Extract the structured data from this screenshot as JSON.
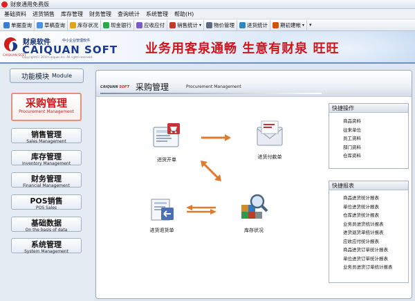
{
  "window": {
    "title": "财泉通用免费版"
  },
  "menu": [
    "基础资料",
    "进货销售",
    "库存管理",
    "财务管理",
    "查询统计",
    "系统管理",
    "帮助(H)"
  ],
  "toolbar": [
    {
      "label": "单据查询",
      "icon": "document-search-icon",
      "color": "#3a7bd5",
      "dropdown": false
    },
    {
      "label": "草稿查询",
      "icon": "draft-icon",
      "color": "#4a90e2",
      "dropdown": false
    },
    {
      "label": "库存状况",
      "icon": "inventory-icon",
      "color": "#e0a31a",
      "dropdown": false
    },
    {
      "label": "现金银行",
      "icon": "bank-icon",
      "color": "#2aa84a",
      "dropdown": false
    },
    {
      "label": "应收应付",
      "icon": "receivable-icon",
      "color": "#7a5cc8",
      "dropdown": false
    },
    {
      "label": "销售统计",
      "icon": "sales-chart-icon",
      "color": "#c0392b",
      "dropdown": true
    },
    {
      "label": "物价管理",
      "icon": "price-grid-icon",
      "color": "#5b6b7f",
      "dropdown": false
    },
    {
      "label": "进货统计",
      "icon": "purchase-chart-icon",
      "color": "#2e86c1",
      "dropdown": false
    },
    {
      "label": "期初建帐",
      "icon": "opening-account-icon",
      "color": "#d35400",
      "dropdown": true
    }
  ],
  "toolbar_more": "▾",
  "banner": {
    "logo_cn": "财泉软件",
    "logo_tagline": "中小企业管理软件",
    "logo_en": "CAIQUAN SOFT",
    "logo_small": "CAIQUAN SOFT",
    "copyright": "Copyright(C) 2010 Caiquan Inc. All rights reserved.",
    "slogan": "业务用客泉通畅    生意有财泉 旺旺"
  },
  "sidebar": {
    "header_cn": "功能模块",
    "header_en": "Module",
    "modules": [
      {
        "cn": "采购管理",
        "en": "Procurement Management",
        "active": true
      },
      {
        "cn": "销售管理",
        "en": "Sales Management",
        "active": false
      },
      {
        "cn": "库存管理",
        "en": "Inventory Management",
        "active": false
      },
      {
        "cn": "财务管理",
        "en": "Financial Management",
        "active": false
      },
      {
        "cn": "POS销售",
        "en": "POS Sales",
        "active": false
      },
      {
        "cn": "基础数据",
        "en": "On the basis of data",
        "active": false
      },
      {
        "cn": "系统管理",
        "en": "System Management",
        "active": false
      }
    ]
  },
  "main": {
    "brand_a": "CAIQUAN",
    "brand_b": "SOFT",
    "title_cn": "采购管理",
    "title_en": "Procurement Management",
    "flow": {
      "purchase_order": "进货开单",
      "payment": "进货付款单",
      "return_order": "进货退货单",
      "stock": "库存状况"
    },
    "quick_ops": {
      "title": "快捷操作",
      "items": [
        "商品资料",
        "往来单位",
        "员工资料",
        "部门资料",
        "仓库资料"
      ]
    },
    "quick_reports": {
      "title": "快捷报表",
      "items": [
        "商品进货统计报表",
        "单位进货统计报表",
        "仓库进货统计报表",
        "业务员进货统计报表",
        "进货退货单统计报表",
        "应收应付统计报表",
        "商品进货订单统计报表",
        "单位进货订单统计报表",
        "业务员进货订单统计报表"
      ]
    }
  },
  "colors": {
    "accent_red": "#d01818",
    "banner_blue": "#1a3a8f",
    "flow_arrow": "#e07a2c"
  }
}
